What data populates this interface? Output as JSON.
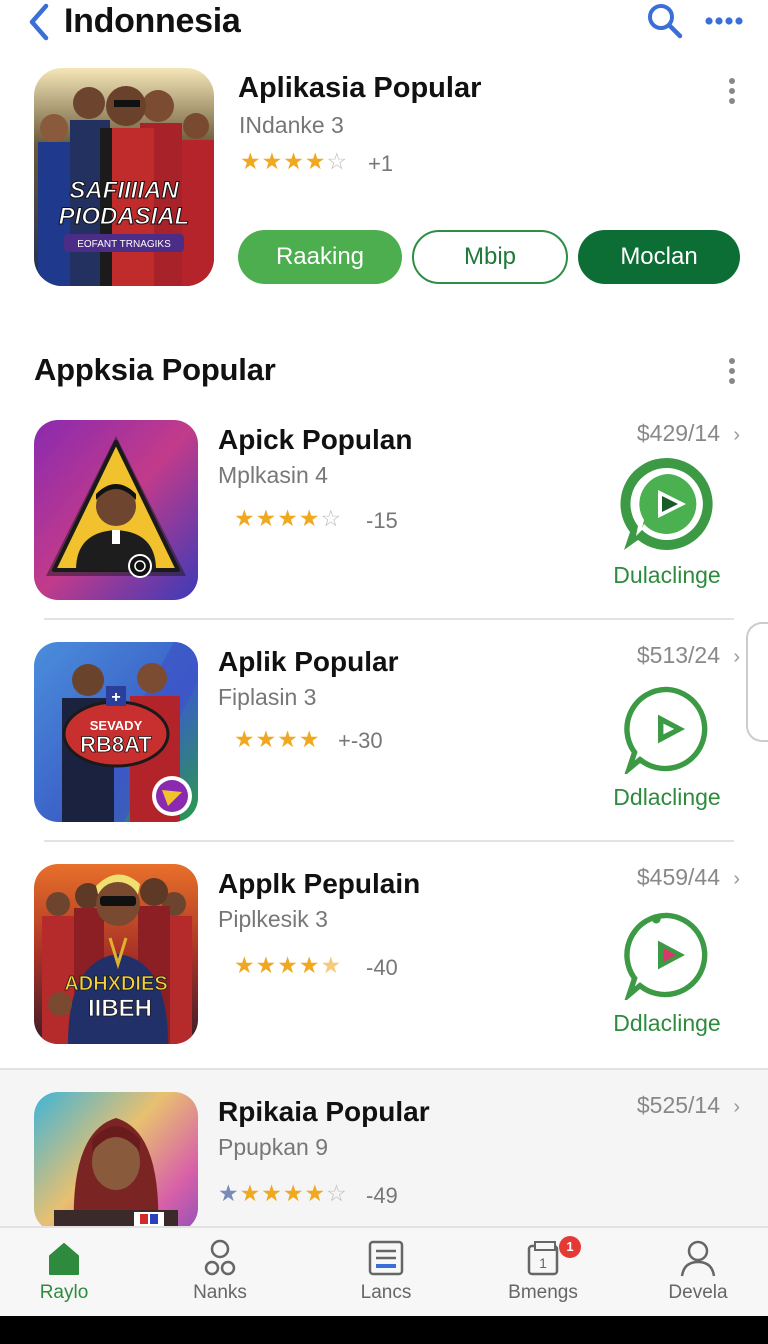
{
  "header": {
    "title": "Indonnesia"
  },
  "featured": {
    "title": "Aplikasia Popular",
    "subtitle": "INdanke 3",
    "rating_stars": 4,
    "rating_count": "+1",
    "poster_text_1": "SAFIIIIAN",
    "poster_text_2": "PIODASIAL",
    "poster_text_3": "EOFANT TRNAGIKS",
    "buttons": [
      "Raaking",
      "Mbip",
      "Moclan"
    ]
  },
  "section": {
    "title": "Appksia Popular"
  },
  "apps": [
    {
      "title": "Apick Populan",
      "subtitle": "Mplkasin 4",
      "rating_stars": 4,
      "rating_count": "-15",
      "price": "$429/14",
      "action": "Dulaclinge"
    },
    {
      "title": "Aplik Popular",
      "subtitle": "Fiplasin 3",
      "rating_stars": 4,
      "rating_count": "+-30",
      "price": "$513/24",
      "action": "Ddlaclinge",
      "poster_text_1": "SEVADY",
      "poster_text_2": "RB8AT"
    },
    {
      "title": "Applk Pepulain",
      "subtitle": "Piplkesik 3",
      "rating_stars": 4.5,
      "rating_count": "-40",
      "price": "$459/44",
      "action": "Ddlaclinge",
      "poster_text_1": "ADHXDIES",
      "poster_text_2": "IIBEH"
    },
    {
      "title": "Rpikaia Popular",
      "subtitle": "Ppupkan 9",
      "rating_stars": 4,
      "rating_count": "-49",
      "price": "$525/14"
    }
  ],
  "tabs": [
    {
      "label": "Raylo",
      "icon": "home-icon",
      "active": true
    },
    {
      "label": "Nanks",
      "icon": "circles-icon"
    },
    {
      "label": "Lancs",
      "icon": "list-icon"
    },
    {
      "label": "Bmengs",
      "icon": "calendar-icon",
      "badge": "1"
    },
    {
      "label": "Devela",
      "icon": "person-icon"
    }
  ],
  "colors": {
    "accent_green": "#2e8b3e",
    "star": "#f0a820",
    "link_blue": "#3a6fd8"
  }
}
